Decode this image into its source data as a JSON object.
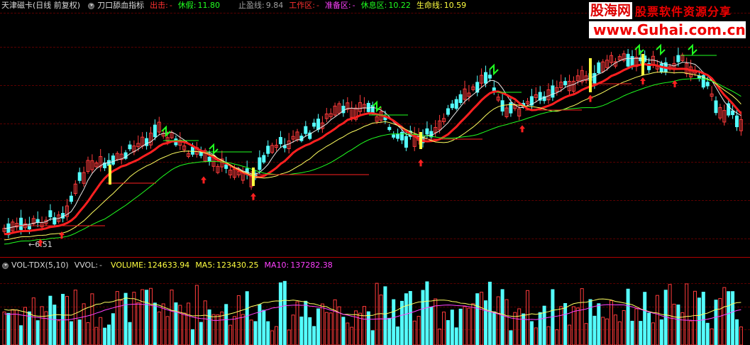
{
  "price_header": {
    "stock_name": "天津磁卡(日线 前复权)",
    "indicator_name": "刀口舔血指标",
    "exit_label": "出击:",
    "exit_value": "-",
    "rest_label": "休假:",
    "rest_value": "11.80",
    "stop_label": "止盈线:",
    "stop_value": "9.84",
    "work_label": "工作区:",
    "work_value": "-",
    "prep_label": "准备区:",
    "prep_value": "-",
    "restzone_label": "休息区:",
    "restzone_value": "10.22",
    "life_label": "生命线:",
    "life_value": "10.59"
  },
  "volume_header": {
    "indicator": "VOL-TDX(5,10)",
    "vvol_label": "VVOL:",
    "vvol_value": "-",
    "volume_label": "VOLUME:",
    "volume_value": "124633.94",
    "ma5_label": "MA5:",
    "ma5_value": "123430.25",
    "ma10_label": "MA10:",
    "ma10_value": "137282.38"
  },
  "low_marker": "6.51",
  "watermark": {
    "brand": "股海网",
    "slogan": "股票软件资源分享",
    "url": "www.Guhai.com.cn"
  },
  "colors": {
    "up": "#ff3b3b",
    "down": "#54ffff",
    "red_line": "#ff2020",
    "yellow_line": "#ffff60",
    "white_line": "#e8e8e8",
    "green_line": "#20ff20",
    "magenta_line": "#ff40ff",
    "grid": "#5a0000"
  },
  "icons": {
    "menu": "circle-dropdown-icon",
    "buy_signal": "up-arrow-icon",
    "sell_signal": "sell-glyph-icon"
  }
}
